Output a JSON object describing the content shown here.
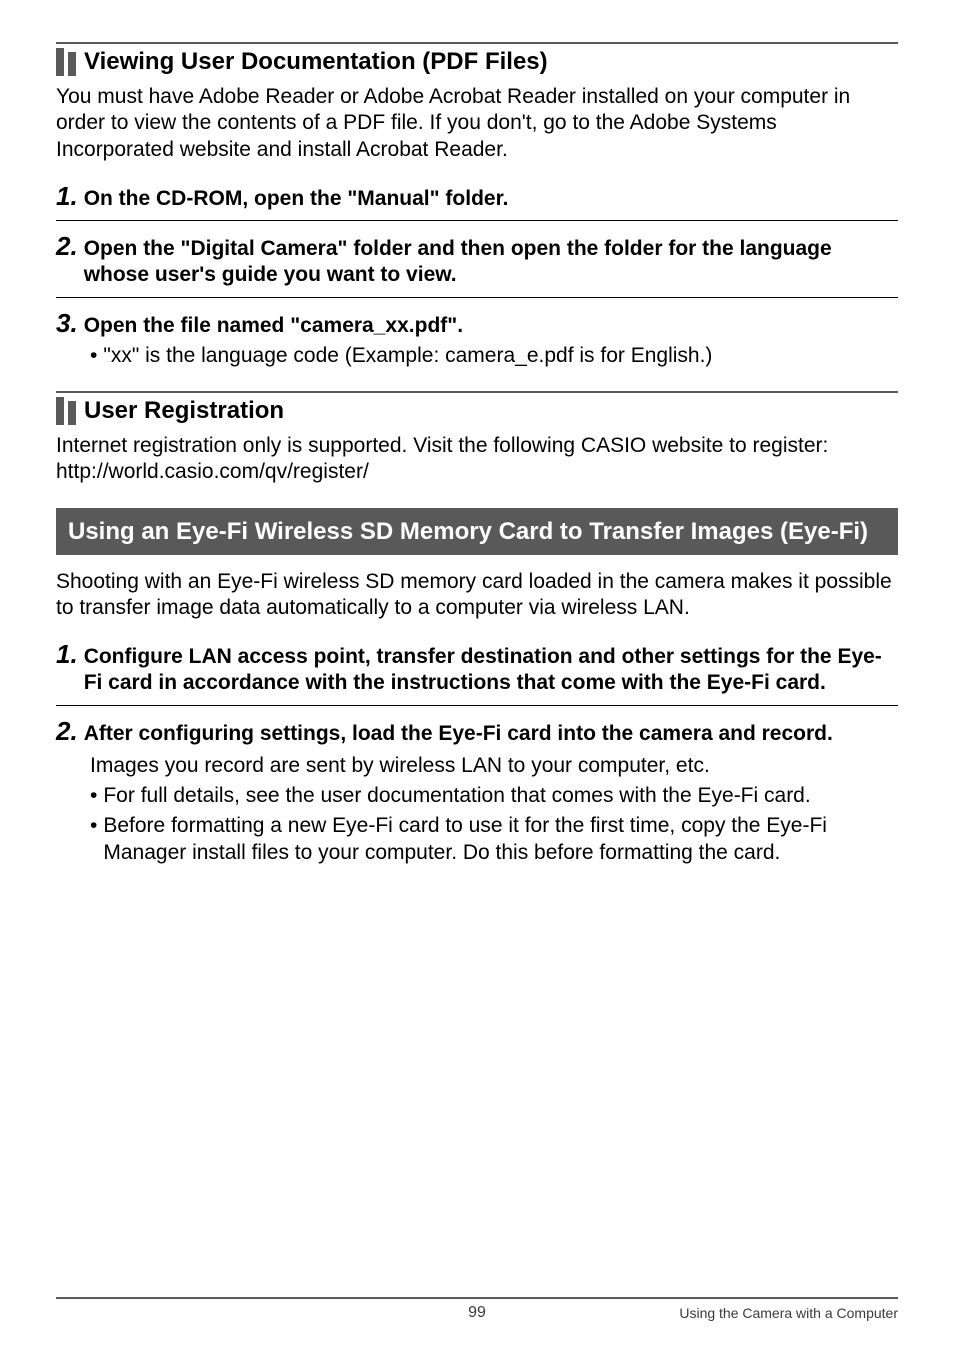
{
  "section1": {
    "heading": "Viewing User Documentation (PDF Files)",
    "intro": "You must have Adobe Reader or Adobe Acrobat Reader installed on your computer in order to view the contents of a PDF file. If you don't, go to the Adobe Systems Incorporated website and install Acrobat Reader.",
    "steps": [
      {
        "num": "1.",
        "text": "On the CD-ROM, open the \"Manual\" folder.",
        "sub": []
      },
      {
        "num": "2.",
        "text": "Open the \"Digital Camera\" folder and then open the folder for the language whose user's guide you want to view.",
        "sub": []
      },
      {
        "num": "3.",
        "text": "Open the file named \"camera_xx.pdf\".",
        "sub": [
          "\"xx\" is the language code (Example: camera_e.pdf is for English.)"
        ]
      }
    ]
  },
  "section2": {
    "heading": "User Registration",
    "body1": "Internet registration only is supported. Visit the following CASIO website to register:",
    "body2": "http://world.casio.com/qv/register/"
  },
  "section3": {
    "heading": "Using an Eye-Fi Wireless SD Memory Card to Transfer Images (Eye-Fi)",
    "intro": "Shooting with an Eye-Fi wireless SD memory card loaded in the camera makes it possible to transfer image data automatically to a computer via wireless LAN.",
    "steps": [
      {
        "num": "1.",
        "text": "Configure LAN access point, transfer destination and other settings for the Eye-Fi card in accordance with the instructions that come with the Eye-Fi card.",
        "sub": [],
        "after": ""
      },
      {
        "num": "2.",
        "text": "After configuring settings, load the Eye-Fi card into the camera and record.",
        "sub": [
          "For full details, see the user documentation that comes with the Eye-Fi card.",
          "Before formatting a new Eye-Fi card to use it for the first time, copy the Eye-Fi Manager install files to your computer. Do this before formatting the card."
        ],
        "after": "Images you record are sent by wireless LAN to your computer, etc."
      }
    ]
  },
  "footer": {
    "page": "99",
    "right": "Using the Camera with a Computer"
  }
}
